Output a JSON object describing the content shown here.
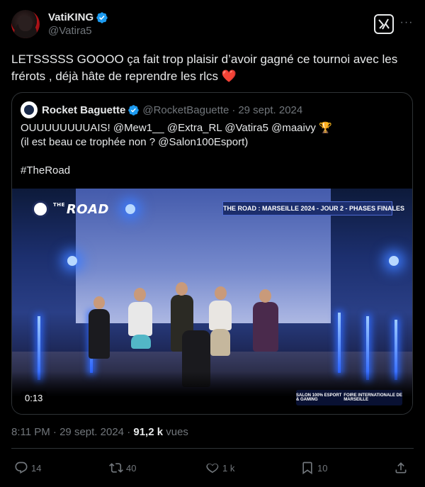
{
  "author": {
    "display_name": "VatiKING",
    "handle": "@Vatira5",
    "avatar_icon": "user-avatar",
    "verified_icon": "verified-badge-icon"
  },
  "tweet": {
    "text": "LETSSSSS GOOOO ça fait trop plaisir d’avoir gagné ce tournoi avec les frérots , déjà hâte de reprendre les rlcs",
    "emoji": "❤️"
  },
  "quote": {
    "display_name": "Rocket Baguette",
    "handle": "@RocketBaguette",
    "separator": "·",
    "date": "29 sept. 2024",
    "lines": [
      "OUUUUUUUUAIS! @Mew1__ @Extra_RL @Vatira5 @maaivy 🏆",
      "(il est beau ce trophée non ? @Salon100Esport)",
      "",
      "#TheRoad"
    ],
    "video": {
      "logo_text": "ROAD",
      "logo_small": "THE",
      "banner": "THE ROAD : MARSEILLE 2024 - JOUR 2 - PHASES FINALES",
      "duration": "0:13",
      "sponsor_1": "SALON 100% ESPORT & GAMING",
      "sponsor_2": "FOIRE INTERNATIONALE DE MARSEILLE"
    }
  },
  "meta": {
    "time": "8:11 PM",
    "separator": "·",
    "date": "29 sept. 2024",
    "views_count": "91,2 k",
    "views_label": "vues"
  },
  "actions": {
    "replies": "14",
    "retweets": "40",
    "likes": "1 k",
    "bookmarks": "10"
  },
  "colors": {
    "background": "#000000",
    "text": "#e7e9ea",
    "secondary": "#71767b",
    "border": "#2f3336",
    "verified": "#1d9bf0",
    "heart": "#e0245e"
  }
}
